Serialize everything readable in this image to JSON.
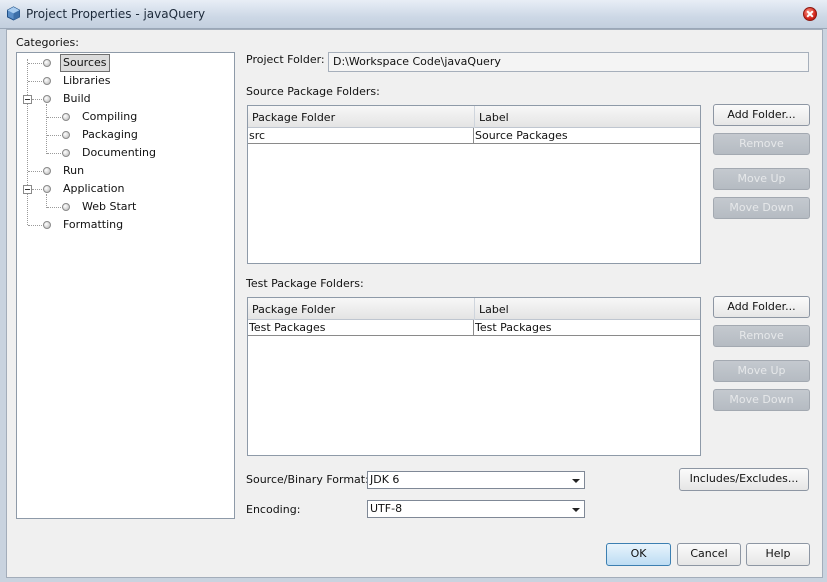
{
  "window": {
    "title": "Project Properties - javaQuery"
  },
  "categories": {
    "label": "Categories:",
    "items": [
      {
        "label": "Sources",
        "selected": true
      },
      {
        "label": "Libraries"
      },
      {
        "label": "Build",
        "expanded": true
      },
      {
        "label": "Compiling"
      },
      {
        "label": "Packaging"
      },
      {
        "label": "Documenting"
      },
      {
        "label": "Run"
      },
      {
        "label": "Application",
        "expanded": true
      },
      {
        "label": "Web Start"
      },
      {
        "label": "Formatting"
      }
    ]
  },
  "project_folder": {
    "label": "Project Folder:",
    "value": "D:\\Workspace Code\\javaQuery"
  },
  "source_folders": {
    "label": "Source Package Folders:",
    "columns": [
      "Package Folder",
      "Label"
    ],
    "rows": [
      {
        "folder": "src",
        "label": "Source Packages"
      }
    ],
    "buttons": {
      "add": "Add Folder...",
      "remove": "Remove",
      "move_up": "Move Up",
      "move_down": "Move Down"
    }
  },
  "test_folders": {
    "label": "Test Package Folders:",
    "columns": [
      "Package Folder",
      "Label"
    ],
    "rows": [
      {
        "folder": "Test Packages",
        "label": "Test Packages"
      }
    ],
    "buttons": {
      "add": "Add Folder...",
      "remove": "Remove",
      "move_up": "Move Up",
      "move_down": "Move Down"
    }
  },
  "format": {
    "label": "Source/Binary Format:",
    "value": "JDK 6",
    "includes_button": "Includes/Excludes..."
  },
  "encoding": {
    "label": "Encoding:",
    "value": "UTF-8"
  },
  "footer": {
    "ok": "OK",
    "cancel": "Cancel",
    "help": "Help"
  }
}
